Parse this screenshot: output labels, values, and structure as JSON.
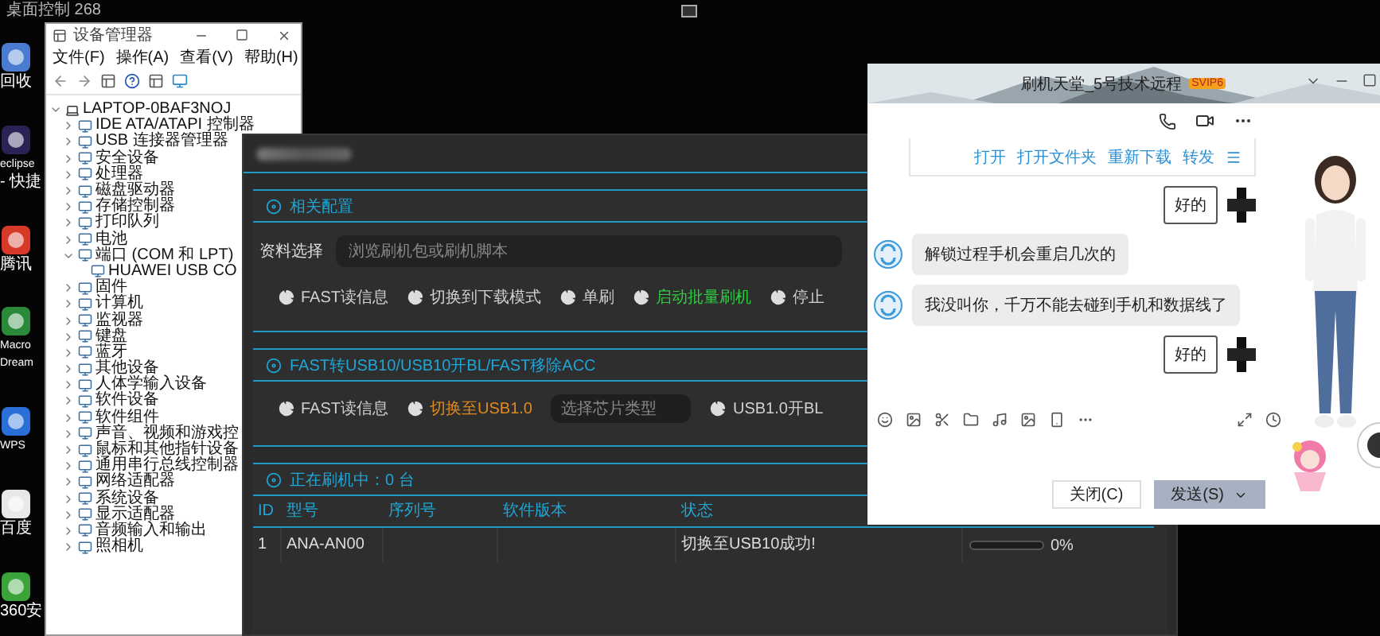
{
  "top_bar": {
    "title": "桌面控制 268"
  },
  "desktop_icons": [
    {
      "lines": [
        "回收"
      ]
    },
    {
      "lines": [
        "eclipse",
        "- 快捷"
      ]
    },
    {
      "lines": [
        "腾讯"
      ]
    },
    {
      "lines": [
        "Macro",
        "Dream"
      ]
    },
    {
      "lines": [
        "WPS"
      ]
    },
    {
      "lines": [
        "百度"
      ]
    },
    {
      "lines": [
        "360安"
      ]
    }
  ],
  "device_manager": {
    "title": "设备管理器",
    "menu": [
      "文件(F)",
      "操作(A)",
      "查看(V)",
      "帮助(H)"
    ],
    "tree": {
      "label": "LAPTOP-0BAF3NOJ",
      "expanded": true,
      "children": [
        {
          "label": "IDE ATA/ATAPI 控制器",
          "expanded": false
        },
        {
          "label": "USB 连接器管理器",
          "expanded": false
        },
        {
          "label": "安全设备",
          "expanded": false
        },
        {
          "label": "处理器",
          "expanded": false
        },
        {
          "label": "磁盘驱动器",
          "expanded": false
        },
        {
          "label": "存储控制器",
          "expanded": false
        },
        {
          "label": "打印队列",
          "expanded": false
        },
        {
          "label": "电池",
          "expanded": false
        },
        {
          "label": "端口 (COM 和 LPT)",
          "expanded": true,
          "children": [
            {
              "label": "HUAWEI USB CO"
            }
          ]
        },
        {
          "label": "固件",
          "expanded": false
        },
        {
          "label": "计算机",
          "expanded": false
        },
        {
          "label": "监视器",
          "expanded": false
        },
        {
          "label": "键盘",
          "expanded": false
        },
        {
          "label": "蓝牙",
          "expanded": false
        },
        {
          "label": "其他设备",
          "expanded": false
        },
        {
          "label": "人体学输入设备",
          "expanded": false
        },
        {
          "label": "软件设备",
          "expanded": false
        },
        {
          "label": "软件组件",
          "expanded": false
        },
        {
          "label": "声音、视频和游戏控",
          "expanded": false
        },
        {
          "label": "鼠标和其他指针设备",
          "expanded": false
        },
        {
          "label": "通用串行总线控制器",
          "expanded": false
        },
        {
          "label": "网络适配器",
          "expanded": false
        },
        {
          "label": "系统设备",
          "expanded": false
        },
        {
          "label": "显示适配器",
          "expanded": false
        },
        {
          "label": "音频输入和输出",
          "expanded": false
        },
        {
          "label": "照相机",
          "expanded": false
        }
      ]
    }
  },
  "flash_tool": {
    "config": {
      "title": "相关配置",
      "file_label": "资料选择",
      "file_placeholder": "浏览刷机包或刷机脚本",
      "buttons": [
        {
          "kind": "button",
          "label": "FAST读信息",
          "color": "#d0d0d0"
        },
        {
          "kind": "button",
          "label": "切换到下载模式",
          "color": "#d0d0d0"
        },
        {
          "kind": "button",
          "label": "单刷",
          "color": "#d0d0d0"
        },
        {
          "kind": "button",
          "label": "启动批量刷机",
          "color": "#2ecc40"
        },
        {
          "kind": "button",
          "label": "停止",
          "color": "#d0d0d0"
        }
      ]
    },
    "usb": {
      "title": "FAST转USB10/USB10开BL/FAST移除ACC",
      "buttons": [
        {
          "kind": "button",
          "label": "FAST读信息",
          "color": "#d0d0d0"
        },
        {
          "kind": "button",
          "label": "切换至USB1.0",
          "color": "#e08a1e"
        },
        {
          "kind": "select",
          "placeholder": "选择芯片类型"
        },
        {
          "kind": "button",
          "label": "USB1.0开BL",
          "color": "#d0d0d0"
        }
      ]
    },
    "devices": {
      "title": "正在刷机中：0 台",
      "columns": [
        "ID",
        "型号",
        "序列号",
        "软件版本",
        "状态"
      ],
      "rows": [
        {
          "id": "1",
          "model": "ANA-AN00",
          "status": "切换至USB10成功!",
          "level": 0,
          "reading": "0%"
        }
      ]
    }
  },
  "chat": {
    "title": "刷机天堂_5号技术远程",
    "badge": "SVIP6",
    "file_actions": [
      "打开",
      "打开文件夹",
      "重新下载",
      "转发"
    ],
    "messages": [
      {
        "kind": "outgoing",
        "text": "好的"
      },
      {
        "kind": "incoming",
        "text": "解锁过程手机会重启几次的"
      },
      {
        "kind": "incoming",
        "text": "我没叫你，千万不能去碰到手机和数据线了"
      },
      {
        "kind": "outgoing",
        "text": "好的"
      }
    ],
    "buttons": [
      {
        "label": "关闭(C)",
        "kind": "secondary"
      },
      {
        "label": "发送(S)",
        "kind": "primary"
      }
    ]
  }
}
